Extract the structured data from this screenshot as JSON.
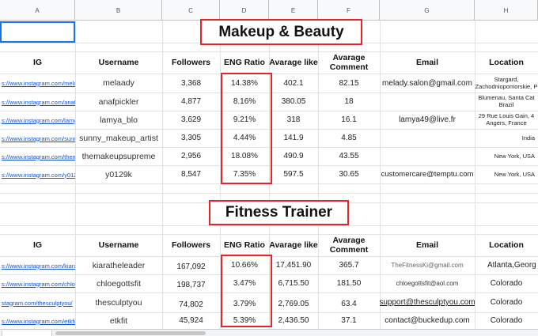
{
  "columns": [
    "A",
    "B",
    "C",
    "D",
    "E",
    "F",
    "G",
    "H"
  ],
  "section1": {
    "title": "Makeup & Beauty",
    "headers": {
      "ig": "IG",
      "username": "Username",
      "followers": "Followers",
      "eng": "ENG Ratio",
      "like": "Avarage like",
      "comment": "Avarage Comment",
      "email": "Email",
      "location": "Location"
    },
    "rows": [
      {
        "ig": "s://www.instagram.com/melaady/",
        "username": "melaady",
        "followers": "3,368",
        "eng": "14.38%",
        "like": "402.1",
        "comment": "82.15",
        "email": "melady.salon@gmail.com",
        "location": "Stargard, Zachodniopomorskie, P"
      },
      {
        "ig": "s://www.instagram.com/anafpickler/",
        "username": "anafpickler",
        "followers": "4,877",
        "eng": "8.16%",
        "like": "380.05",
        "comment": "18",
        "email": "",
        "location": "Blumenau, Santa Cat Brazil"
      },
      {
        "ig": "s://www.instagram.com/lamya_blo/",
        "username": "lamya_blo",
        "followers": "3,629",
        "eng": "9.21%",
        "like": "318",
        "comment": "16.1",
        "email": "lamya49@live.fr",
        "location": "29 Rue Louis Gain, 4 Angers, France"
      },
      {
        "ig": "s://www.instagram.com/sunny_makeup_artist/",
        "username": "sunny_makeup_artist",
        "followers": "3,305",
        "eng": "4.44%",
        "like": "141.9",
        "comment": "4.85",
        "email": "",
        "location": "India"
      },
      {
        "ig": "s://www.instagram.com/themakeupsupreme/",
        "username": "themakeupsupreme",
        "followers": "2,956",
        "eng": "18.08%",
        "like": "490.9",
        "comment": "43.55",
        "email": "",
        "location": "New York, USA"
      },
      {
        "ig": "s://www.instagram.com/y0129k/",
        "username": "y0129k",
        "followers": "8,547",
        "eng": "7.35%",
        "like": "597.5",
        "comment": "30.65",
        "email": "customercare@temptu.com",
        "location": "New York, USA"
      }
    ]
  },
  "section2": {
    "title": "Fitness Trainer",
    "headers": {
      "ig": "IG",
      "username": "Username",
      "followers": "Followers",
      "eng": "ENG Ratio",
      "like": "Avarage like",
      "comment": "Avarage Comment",
      "email": "Email",
      "location": "Location"
    },
    "rows": [
      {
        "ig": "s://www.instagram.com/kiaratheleader/",
        "username": "kiaratheleader",
        "followers": "167,092",
        "eng": "10.66%",
        "like": "17,451.90",
        "comment": "365.7",
        "email": "TheFitnessKi@gmail.com",
        "location": "Atlanta,Georg"
      },
      {
        "ig": "s://www.instagram.com/chloegottsfit/",
        "username": "chloegottsfit",
        "followers": "198,737",
        "eng": "3.47%",
        "like": "6,715.50",
        "comment": "181.50",
        "email": "chloegottsfit@aol.com",
        "location": "Colorado"
      },
      {
        "ig": "stagram.com/thesculptyou/",
        "username": "thesculptyou",
        "followers": "74,802",
        "eng": "3.79%",
        "like": "2,769.05",
        "comment": "63.4",
        "email": "support@thesculptyou.com",
        "location": "Colorado"
      },
      {
        "ig": "s://www.instagram.com/etkfit/",
        "username": "etkfit",
        "followers": "45,924",
        "eng": "5.39%",
        "like": "2,436.50",
        "comment": "37.1",
        "email": "contact@buckedup.com",
        "location": "Colorado"
      }
    ]
  },
  "colors": {
    "highlight": "#e8242a",
    "link": "#1155cc",
    "selection": "#1a73e8"
  }
}
